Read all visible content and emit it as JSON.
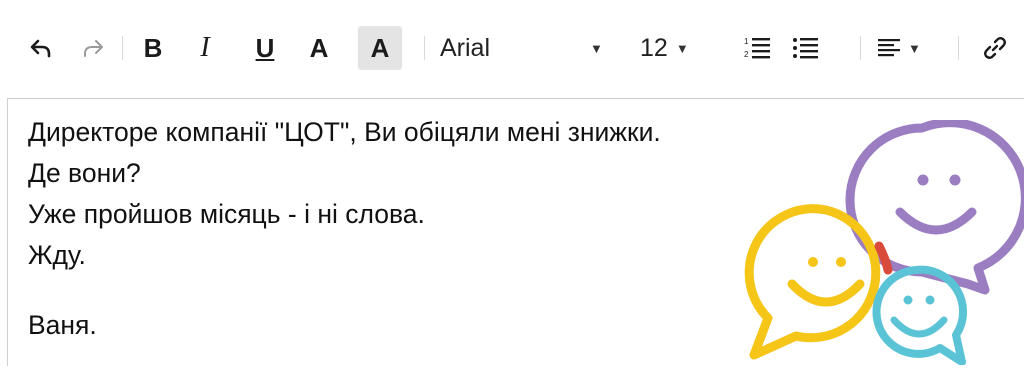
{
  "toolbar": {
    "undo_icon": "undo-icon",
    "redo_icon": "redo-icon",
    "bold_label": "B",
    "italic_label": "I",
    "underline_label": "U",
    "text_color_label": "A",
    "highlight_label": "A",
    "font_name": "Arial",
    "font_size": "12",
    "numbered_list_icon": "numbered-list-icon",
    "bullet_list_icon": "bullet-list-icon",
    "align_icon": "align-left-icon",
    "link_icon": "link-icon"
  },
  "editor": {
    "lines": [
      "Директоре компанії \"ЦОТ\", Ви обіцяли мені знижки.",
      "Де вони?",
      "Уже пройшов місяць - і ні слова.",
      "Жду.",
      "",
      "Ваня."
    ]
  },
  "decoration": {
    "colors": {
      "purple": "#9b7dc2",
      "yellow": "#f5c518",
      "cyan": "#5bc3d6",
      "red_overlap": "#d94a3a"
    }
  }
}
